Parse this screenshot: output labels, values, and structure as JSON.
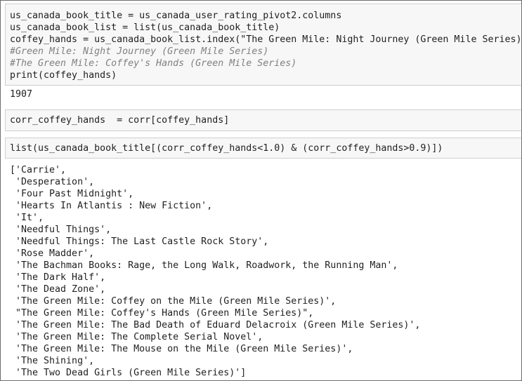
{
  "cell1": {
    "lines": [
      {
        "text": "us_canada_book_title = us_canada_user_rating_pivot2.columns",
        "kind": "code"
      },
      {
        "text": "us_canada_book_list = list(us_canada_book_title)",
        "kind": "code"
      },
      {
        "text": "coffey_hands = us_canada_book_list.index(\"The Green Mile: Night Journey (Green Mile Series)\")",
        "kind": "code"
      },
      {
        "text": "#Green Mile: Night Journey (Green Mile Series)",
        "kind": "comment"
      },
      {
        "text": "#The Green Mile: Coffey's Hands (Green Mile Series)",
        "kind": "comment"
      },
      {
        "text": "print(coffey_hands)",
        "kind": "code"
      }
    ],
    "output": "1907"
  },
  "cell2": {
    "code": "corr_coffey_hands  = corr[coffey_hands]"
  },
  "cell3": {
    "code": "list(us_canada_book_title[(corr_coffey_hands<1.0) & (corr_coffey_hands>0.9)])",
    "output_lines": [
      "['Carrie',",
      " 'Desperation',",
      " 'Four Past Midnight',",
      " 'Hearts In Atlantis : New Fiction',",
      " 'It',",
      " 'Needful Things',",
      " 'Needful Things: The Last Castle Rock Story',",
      " 'Rose Madder',",
      " 'The Bachman Books: Rage, the Long Walk, Roadwork, the Running Man',",
      " 'The Dark Half',",
      " 'The Dead Zone',",
      " 'The Green Mile: Coffey on the Mile (Green Mile Series)',",
      " \"The Green Mile: Coffey's Hands (Green Mile Series)\",",
      " 'The Green Mile: The Bad Death of Eduard Delacroix (Green Mile Series)',",
      " 'The Green Mile: The Complete Serial Novel',",
      " 'The Green Mile: The Mouse on the Mile (Green Mile Series)',",
      " 'The Shining',",
      " 'The Two Dead Girls (Green Mile Series)']"
    ]
  }
}
